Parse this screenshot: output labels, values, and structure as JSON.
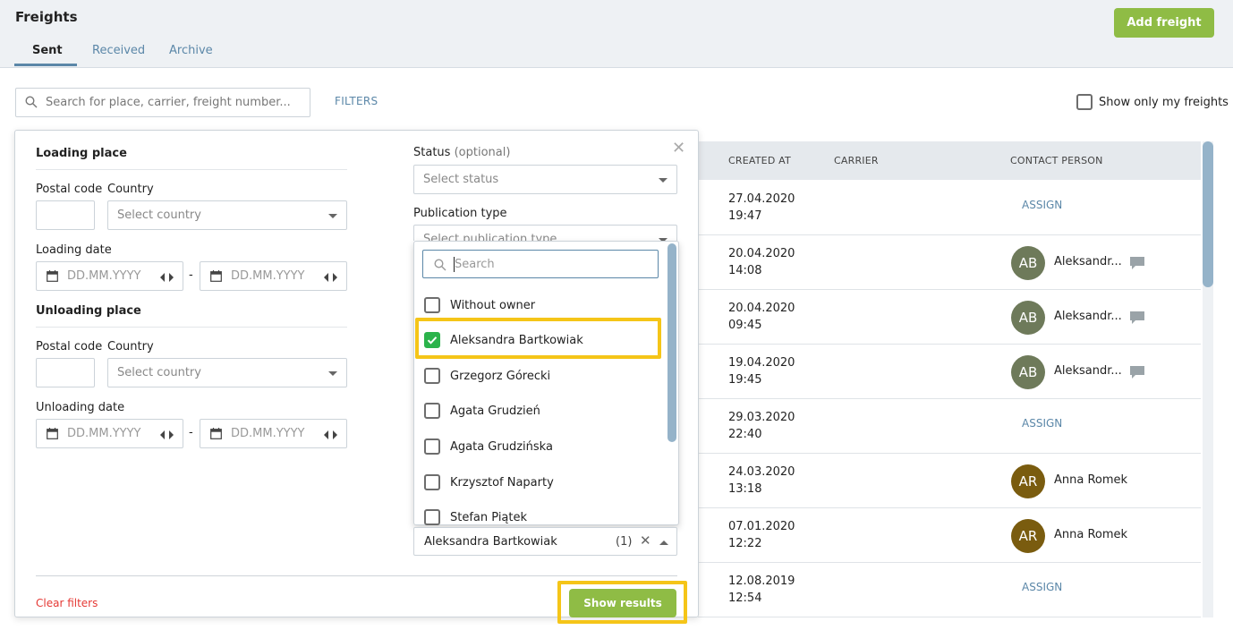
{
  "header": {
    "title": "Freights",
    "add_button": "Add freight",
    "tabs": [
      {
        "label": "Sent",
        "active": true
      },
      {
        "label": "Received",
        "active": false
      },
      {
        "label": "Archive",
        "active": false
      }
    ]
  },
  "toolbar": {
    "search_placeholder": "Search for place, carrier, freight number...",
    "filters_label": "FILTERS",
    "show_only_mine": "Show only my freights"
  },
  "table": {
    "columns": [
      "CREATED AT",
      "CARRIER",
      "CONTACT PERSON"
    ],
    "rows": [
      {
        "date": "27.04.2020",
        "time": "19:47",
        "contact": "ASSIGN"
      },
      {
        "date": "20.04.2020",
        "time": "14:08",
        "initials": "AB",
        "contact": "Aleksandr..."
      },
      {
        "date": "20.04.2020",
        "time": "09:45",
        "initials": "AB",
        "contact": "Aleksandr..."
      },
      {
        "date": "19.04.2020",
        "time": "19:45",
        "initials": "AB",
        "contact": "Aleksandr..."
      },
      {
        "date": "29.03.2020",
        "time": "22:40",
        "contact": "ASSIGN"
      },
      {
        "date": "24.03.2020",
        "time": "13:18",
        "initials": "AR",
        "contact": "Anna Romek"
      },
      {
        "date": "07.01.2020",
        "time": "12:22",
        "initials": "AR",
        "contact": "Anna Romek"
      },
      {
        "date": "12.08.2019",
        "time": "12:54",
        "contact": "ASSIGN"
      }
    ]
  },
  "filters": {
    "loading": {
      "title": "Loading place",
      "postal_code": "Postal code",
      "country": "Country",
      "country_placeholder": "Select country",
      "date_label": "Loading date",
      "date_placeholder": "DD.MM.YYYY"
    },
    "unloading": {
      "title": "Unloading place",
      "postal_code": "Postal code",
      "country": "Country",
      "country_placeholder": "Select country",
      "date_label": "Unloading date",
      "date_placeholder": "DD.MM.YYYY"
    },
    "date_separator": "-",
    "status": {
      "label": "Status",
      "optional": "(optional)",
      "placeholder": "Select status"
    },
    "publication": {
      "label": "Publication type",
      "placeholder": "Select publication type"
    },
    "owner_dropdown": {
      "search_placeholder": "Search",
      "options": [
        {
          "label": "Without owner",
          "checked": false
        },
        {
          "label": "Aleksandra Bartkowiak",
          "checked": true
        },
        {
          "label": "Grzegorz Górecki",
          "checked": false
        },
        {
          "label": "Agata Grudzień",
          "checked": false
        },
        {
          "label": "Agata Grudzińska",
          "checked": false
        },
        {
          "label": "Krzysztof Naparty",
          "checked": false
        },
        {
          "label": "Stefan Piątek",
          "checked": false
        }
      ],
      "selected_value": "Aleksandra Bartkowiak",
      "selected_count": "(1)"
    },
    "clear_label": "Clear filters",
    "show_results": "Show results"
  },
  "colors": {
    "accent_green": "#8fbc45",
    "link_blue": "#5b87a8",
    "highlight": "#f5c518",
    "avatar_ab": "#6e7a5a",
    "avatar_ar": "#7a5c0f",
    "check_green": "#2bb34b",
    "clear_red": "#e53935"
  }
}
